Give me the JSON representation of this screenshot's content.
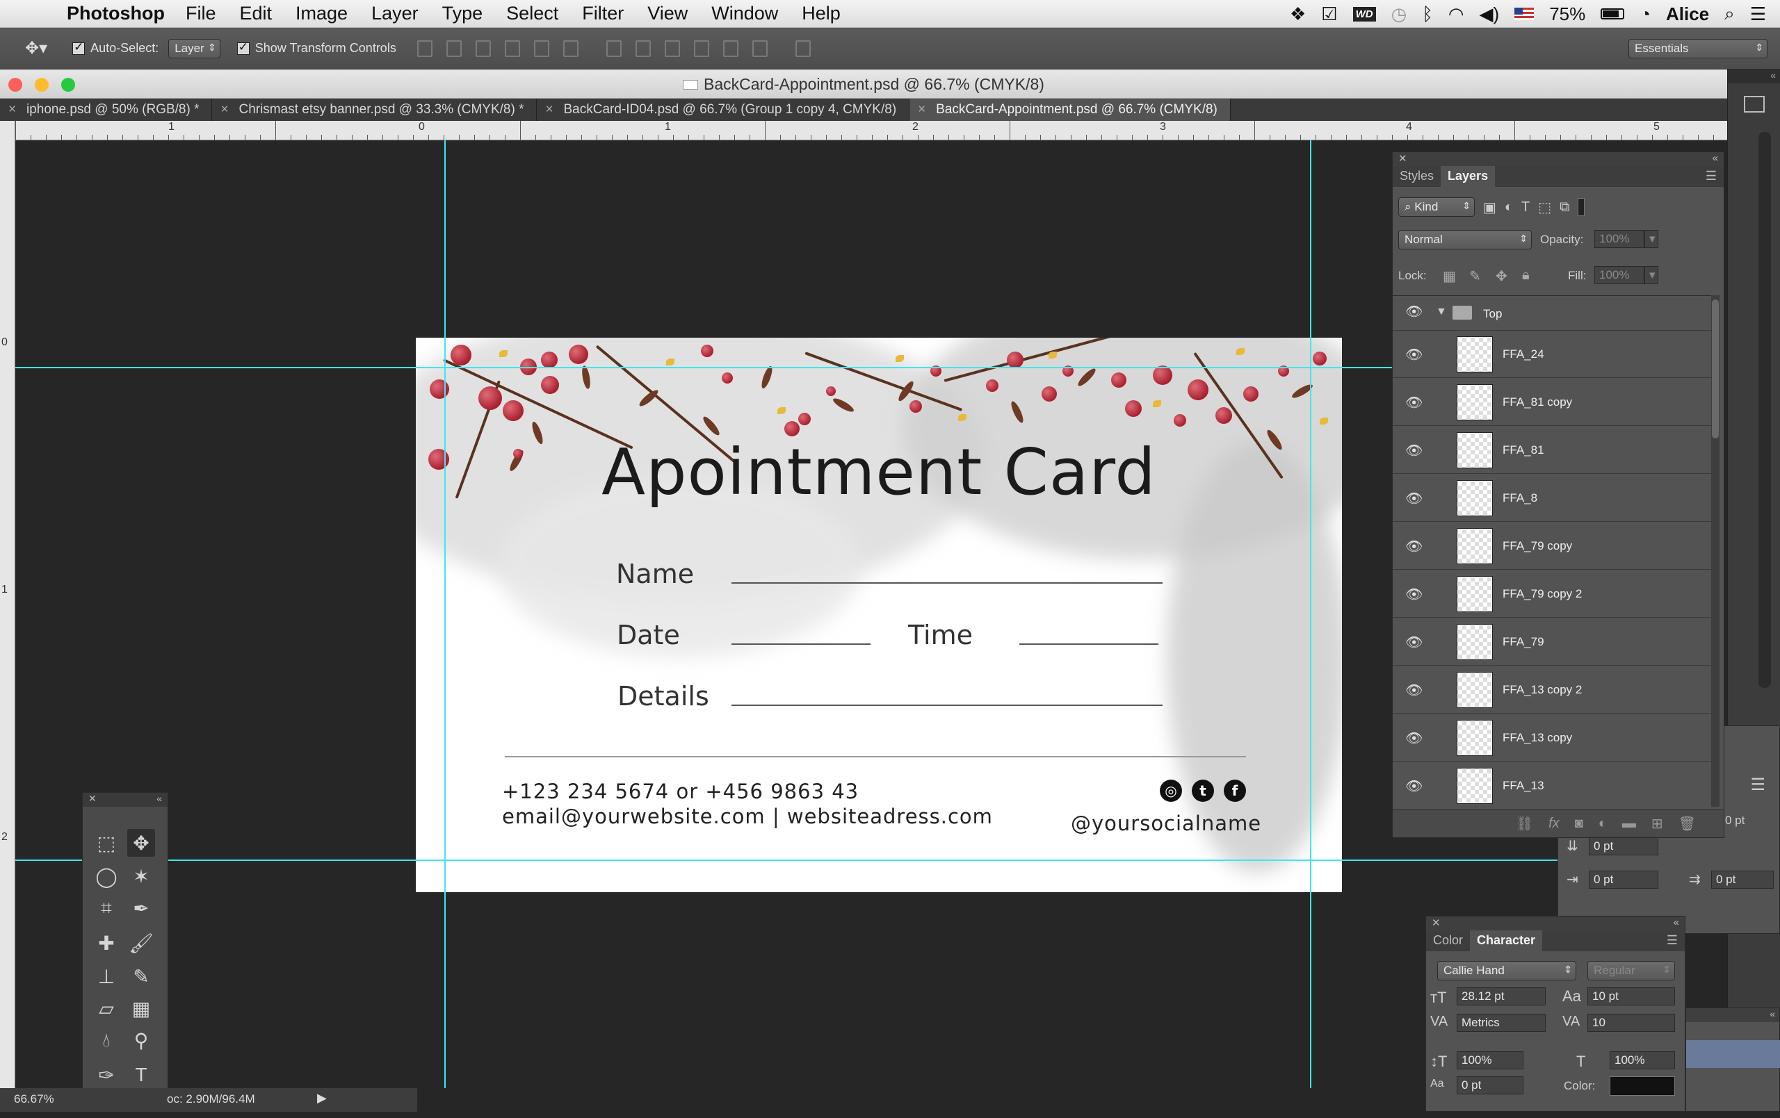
{
  "menubar": {
    "app_name": "Photoshop",
    "items": [
      "File",
      "Edit",
      "Image",
      "Layer",
      "Type",
      "Select",
      "Filter",
      "View",
      "Window",
      "Help"
    ],
    "battery": "75%",
    "user": "Alice"
  },
  "options": {
    "auto_select_label": "Auto-Select:",
    "auto_select_value": "Layer",
    "show_transform_label": "Show Transform Controls",
    "workspace": "Essentials"
  },
  "window": {
    "title": "BackCard-Appointment.psd @ 66.7% (CMYK/8)"
  },
  "tabs": [
    {
      "label": "iphone.psd @ 50% (RGB/8) *"
    },
    {
      "label": "Chrismast etsy banner.psd @ 33.3% (CMYK/8) *"
    },
    {
      "label": "BackCard-ID04.psd @ 66.7% (Group 1 copy 4, CMYK/8)"
    },
    {
      "label": "BackCard-Appointment.psd @ 66.7% (CMYK/8)"
    }
  ],
  "ruler": {
    "h_labels": [
      "1",
      "0",
      "1",
      "2",
      "3",
      "4",
      "5"
    ],
    "v_labels": [
      "0",
      "1",
      "2"
    ]
  },
  "card": {
    "title": "Apointment Card",
    "name_label": "Name",
    "date_label": "Date",
    "time_label": "Time",
    "details_label": "Details",
    "phone": "+123 234 5674 or +456 9863 43",
    "email": "email@yourwebsite.com | websiteadress.com",
    "social": "@yoursocialname"
  },
  "layers_panel": {
    "tabs": [
      "Styles",
      "Layers"
    ],
    "kind_label": "Kind",
    "blend_mode": "Normal",
    "opacity_label": "Opacity:",
    "opacity_value": "100%",
    "lock_label": "Lock:",
    "fill_label": "Fill:",
    "fill_value": "100%",
    "group_name": "Top",
    "layers": [
      {
        "name": "FFA_24"
      },
      {
        "name": "FFA_81 copy"
      },
      {
        "name": "FFA_81"
      },
      {
        "name": "FFA_8"
      },
      {
        "name": "FFA_79 copy"
      },
      {
        "name": "FFA_79 copy 2"
      },
      {
        "name": "FFA_79"
      },
      {
        "name": "FFA_13 copy 2"
      },
      {
        "name": "FFA_13 copy"
      },
      {
        "name": "FFA_13"
      }
    ]
  },
  "paragraph_panel": {
    "v1": "0 pt",
    "v2": "0 pt",
    "v3": "0 pt",
    "v4": "0 pt"
  },
  "character_panel": {
    "tabs": [
      "Color",
      "Character"
    ],
    "font_family": "Callie Hand",
    "font_style": "Regular",
    "font_size": "28.12 pt",
    "leading": "10 pt",
    "kerning": "Metrics",
    "tracking": "10",
    "vscale": "100%",
    "hscale": "100%",
    "baseline": "0 pt",
    "color_label": "Color:"
  },
  "status": {
    "zoom": "66.67%",
    "doc": "oc: 2.90M/96.4M"
  },
  "colors": {
    "guide": "#3fe6f0",
    "berry": "#b3202f",
    "leaf": "#6e3a24"
  }
}
